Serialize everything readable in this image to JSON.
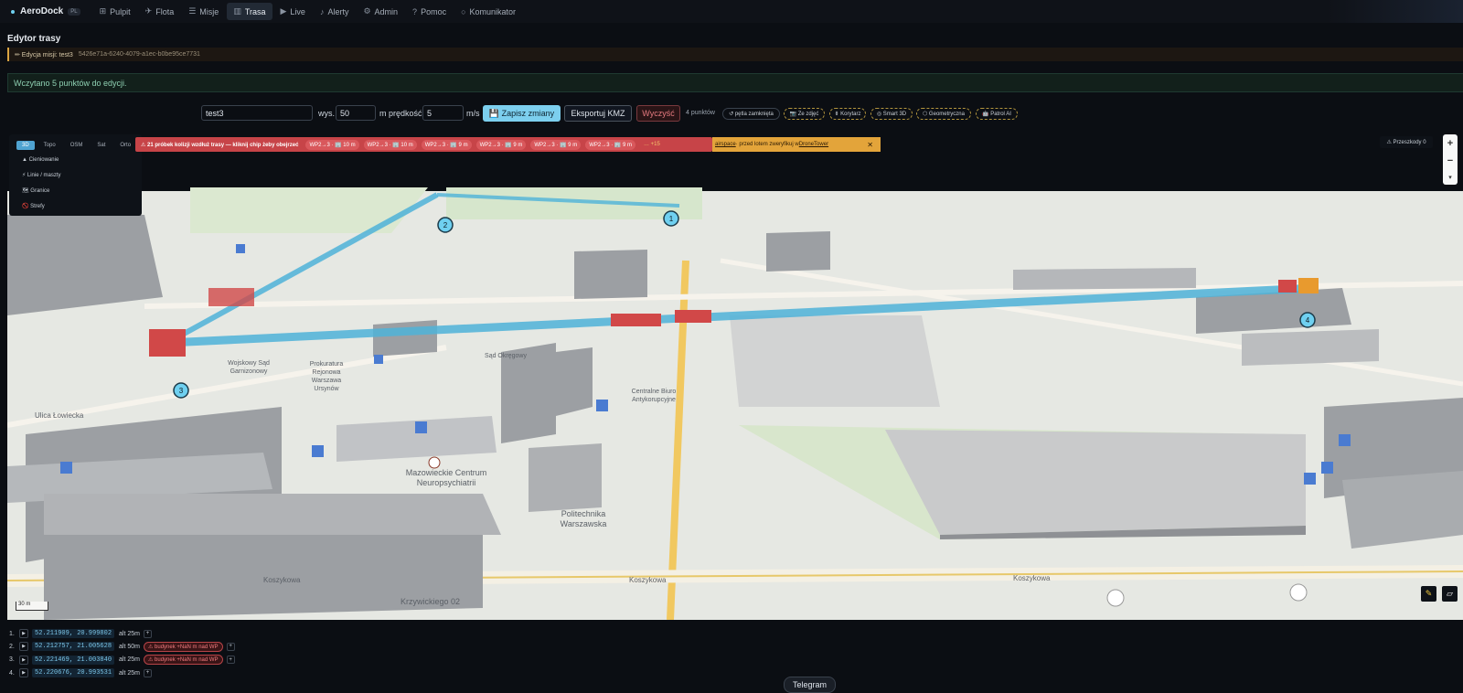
{
  "app": {
    "name": "AeroDock",
    "lang": "PL"
  },
  "nav": [
    {
      "label": "Pulpit",
      "icon": "grid-icon",
      "glyph": "⊞"
    },
    {
      "label": "Flota",
      "icon": "drone-icon",
      "glyph": "✈"
    },
    {
      "label": "Misje",
      "icon": "list-icon",
      "glyph": "☰"
    },
    {
      "label": "Trasa",
      "icon": "map-icon",
      "glyph": "▥",
      "active": true
    },
    {
      "label": "Live",
      "icon": "video-icon",
      "glyph": "▶"
    },
    {
      "label": "Alerty",
      "icon": "bell-icon",
      "glyph": "♪"
    },
    {
      "label": "Admin",
      "icon": "gear-icon",
      "glyph": "⚙"
    },
    {
      "label": "Pomoc",
      "icon": "help-icon",
      "glyph": "?"
    },
    {
      "label": "Komunikator",
      "icon": "chat-icon",
      "glyph": "○"
    }
  ],
  "page": {
    "title": "Edytor trasy"
  },
  "mission": {
    "label": "✏ Edycja misji: test3",
    "id": "5426e71a-6240-4079-a1ec-b0be95ce7731"
  },
  "status": {
    "loaded": "Wczytano 5 punktów do edycji."
  },
  "toolbar": {
    "name_value": "test3",
    "alt_label": "wys.",
    "alt_value": "50",
    "alt_unit": "m",
    "speed_label": "prędkość",
    "speed_value": "5",
    "speed_unit": "m/s",
    "save_label": "💾 Zapisz zmiany",
    "kmz_label": "Eksportuj KMZ",
    "clear_label": "Wyczyść",
    "points_count": "4 punktów",
    "loop_label": "↺ pętla zamknięta",
    "chips": [
      "📷 Ze zdjęć",
      "⇟ Korytarz",
      "◎ Smart 3D",
      "⬡ Geometryczna",
      "🤖 Patrol AI"
    ]
  },
  "layers": {
    "tabs": [
      "3D",
      "Topo",
      "OSM",
      "Sat",
      "Orto"
    ],
    "active_tab": "3D",
    "items": [
      "▲ Cieniowanie",
      "⚡ Linie / maszty",
      "🗺 Granice",
      "🚫 Strefy"
    ]
  },
  "collision": {
    "text": "⚠ 21 próbek kolizji wzdłuż trasy — kliknij chip żeby obejrzeć",
    "chips": [
      "WP2→3 · 🏢 10 m",
      "WP2→3 · 🏢 10 m",
      "WP2→3 · 🏢 9 m",
      "WP2→3 · 🏢 9 m",
      "WP2→3 · 🏢 9 m",
      "WP2→3 · 🏢 9 m"
    ],
    "more": "… +15"
  },
  "airspace": {
    "link1": "airspace",
    "text": " · przed lotem zweryfikuj w ",
    "link2": "DroneTower",
    "close": "✕"
  },
  "obstacles": {
    "label": "⚠ Przeszkody 0"
  },
  "map": {
    "scale": "30 m",
    "labels": [
      "Mazowieckie Centrum",
      "Neuropsychiatrii",
      "Politechnika",
      "Warszawska",
      "Centralne Biuro",
      "Antykorupcyjne",
      "Prokuratura",
      "Rejonowa",
      "Warszawa",
      "Ursynów",
      "Wojskowy Sąd",
      "Garnizonowy",
      "Sąd Okręgowy",
      "Koszykowa",
      "Krzywickiego 02",
      "Ulica Łowiecka"
    ],
    "markers": [
      "1",
      "2",
      "3",
      "4"
    ]
  },
  "waypoints": [
    {
      "n": "1.",
      "coords": "52.211909, 20.999802",
      "alt": "alt 25m",
      "warn": ""
    },
    {
      "n": "2.",
      "coords": "52.212757, 21.005628",
      "alt": "alt 50m",
      "warn": "⚠ budynek +NaN m nad WP"
    },
    {
      "n": "3.",
      "coords": "52.221469, 21.003840",
      "alt": "alt 25m",
      "warn": "⚠ budynek +NaN m nad WP"
    },
    {
      "n": "4.",
      "coords": "52.220676, 20.993531",
      "alt": "alt 25m",
      "warn": ""
    }
  ],
  "telegram": {
    "label": "Telegram"
  }
}
